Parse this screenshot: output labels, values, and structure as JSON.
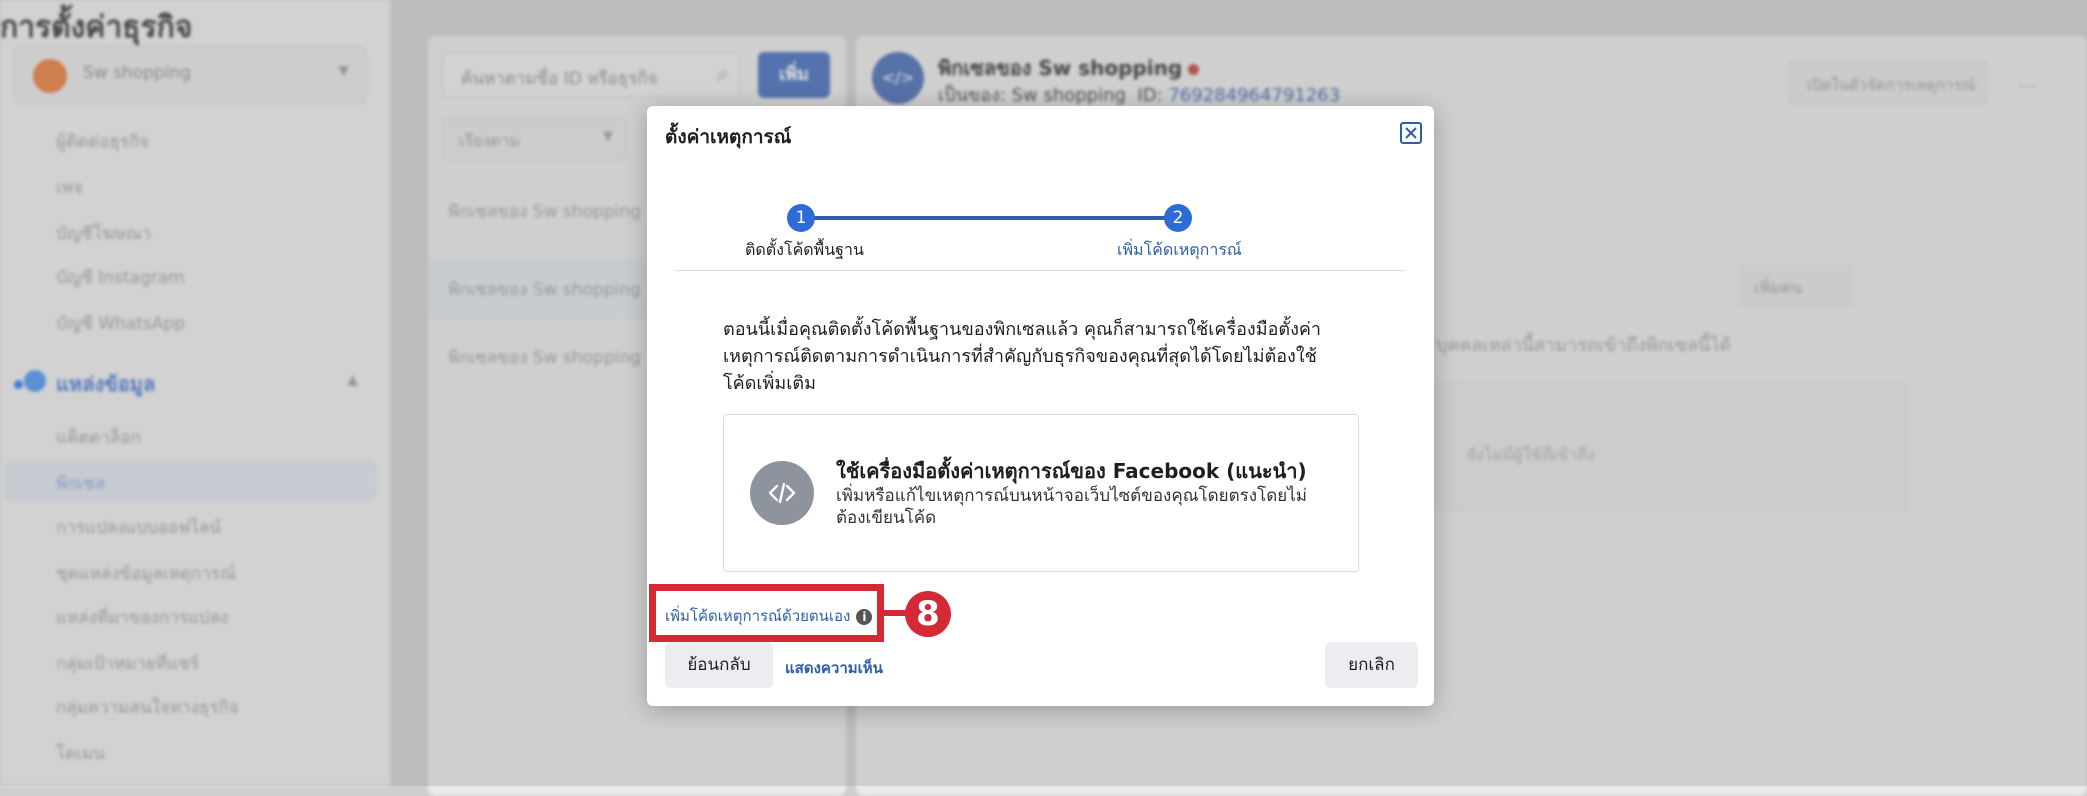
{
  "background": {
    "sidebar": {
      "title": "การตั้งค่าธุรกิจ",
      "account_name": "Sw shopping",
      "items_top": [
        "ผู้ติดต่อธุรกิจ",
        "เพจ",
        "บัญชีโฆษณา",
        "บัญชี Instagram",
        "บัญชี WhatsApp"
      ],
      "section_label": "แหล่งข้อมูล",
      "items_section": [
        "แค็ตตาล็อก",
        "พิกเซล",
        "การแปลงแบบออฟไลน์",
        "ชุดแหล่งข้อมูลเหตุการณ์",
        "แหล่งที่มาของการแปลง",
        "กลุ่มเป้าหมายที่แชร์",
        "กลุ่มความสนใจทางธุรกิจ",
        "โดเมน"
      ]
    },
    "middle": {
      "search_placeholder": "ค้นหาตามชื่อ ID หรือธุรกิจ",
      "add_button": "เพิ่ม",
      "filter_label": "เรียงตาม",
      "rows": [
        "พิกเซลของ Sw shopping",
        "พิกเซลของ Sw shopping",
        "พิกเซลของ Sw shopping"
      ]
    },
    "right": {
      "pixel_name": "พิกเซลของ Sw shopping",
      "owner_prefix": "เป็นของ: Sw shopping",
      "id_label": "ID:",
      "id_value": "769284964791263",
      "open_events_button": "เปิดในตัวจัดการเหตุการณ์",
      "more_icon": "...",
      "share_button": "เพิ่มคน",
      "info_text": "บุคคลเหล่านี้สามารถเข้าถึงพิกเซลนี้ได้",
      "box_text": "ยังไม่มีผู้ใช้ที่เข้าถึง"
    }
  },
  "modal": {
    "title": "ตั้งค่าเหตุการณ์",
    "steps": [
      {
        "number": "1",
        "label": "ติดตั้งโค้ดพื้นฐาน"
      },
      {
        "number": "2",
        "label": "เพิ่มโค้ดเหตุการณ์"
      }
    ],
    "description": "ตอนนี้เมื่อคุณติดตั้งโค้ดพื้นฐานของพิกเซลแล้ว คุณก็สามารถใช้เครื่องมือตั้งค่าเหตุการณ์ติดตามการดำเนินการที่สำคัญกับธุรกิจของคุณที่สุดได้โดยไม่ต้องใช้โค้ดเพิ่มเติม",
    "option": {
      "title": "ใช้เครื่องมือตั้งค่าเหตุการณ์ของ Facebook (แนะนำ)",
      "subtitle": "เพิ่มหรือแก้ไขเหตุการณ์บนหน้าจอเว็บไซต์ของคุณโดยตรงโดยไม่ต้องเขียนโค้ด",
      "icon": "code-icon"
    },
    "manual_link": "เพิ่มโค้ดเหตุการณ์ด้วยตนเอง",
    "info_glyph": "i",
    "back_button": "ย้อนกลับ",
    "feedback_link": "แสดงความเห็น",
    "cancel_button": "ยกเลิก"
  },
  "annotation": {
    "badge": "8",
    "color": "#d42a36"
  }
}
